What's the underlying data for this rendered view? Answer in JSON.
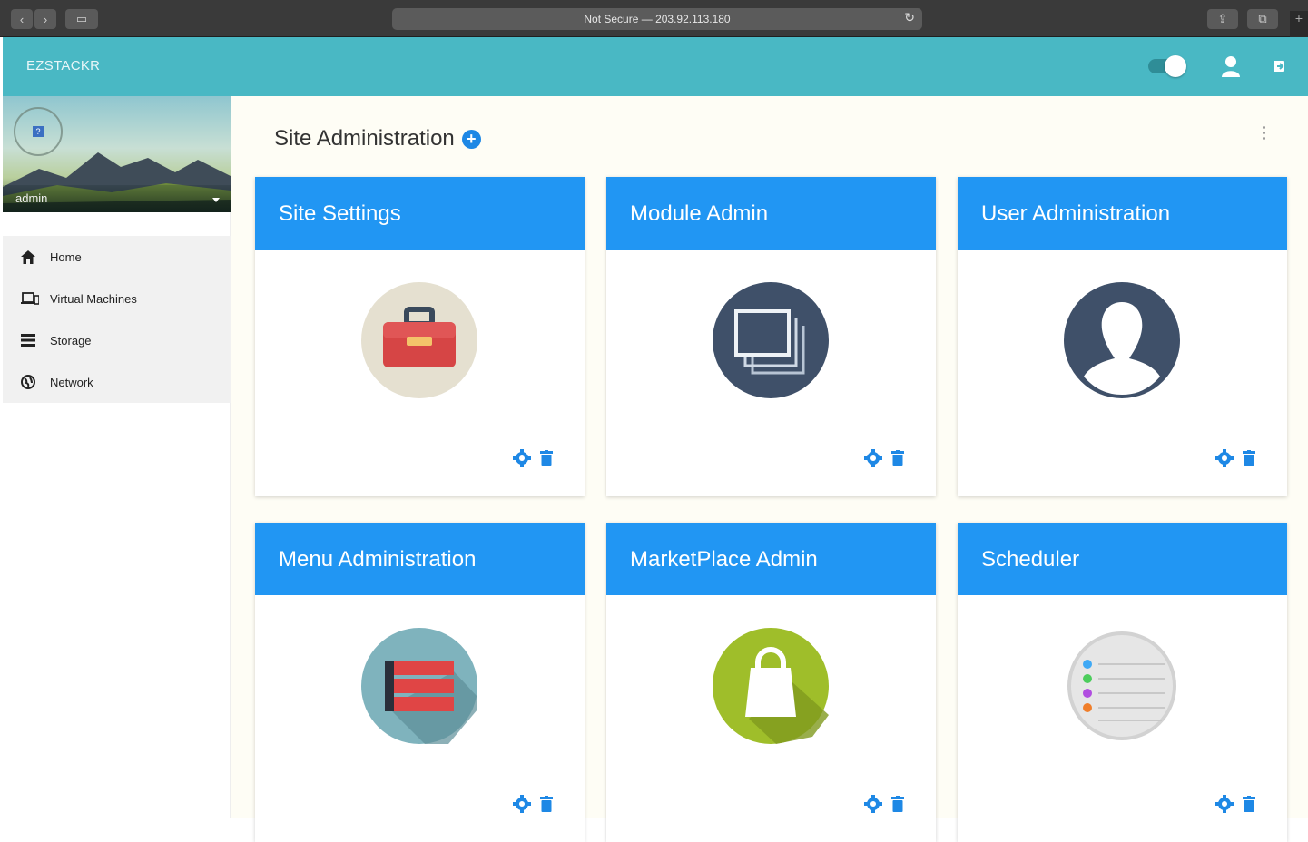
{
  "browser": {
    "address": "Not Secure — 203.92.113.180",
    "colors": {
      "chrome": "#3a3a3a"
    }
  },
  "header": {
    "brand": "EZSTACKR",
    "color": "#49b8c4",
    "icons": [
      "toggle-switch",
      "user-icon",
      "logout-icon"
    ]
  },
  "sidebar": {
    "username": "admin",
    "items": [
      {
        "label": "Home",
        "icon": "home-icon"
      },
      {
        "label": "Virtual Machines",
        "icon": "laptop-icon"
      },
      {
        "label": "Storage",
        "icon": "list-icon"
      },
      {
        "label": "Network",
        "icon": "globe-icon"
      }
    ]
  },
  "main": {
    "title": "Site Administration",
    "accent": "#2196f3",
    "cards": [
      {
        "title": "Site Settings",
        "icon": "toolbox-icon"
      },
      {
        "title": "Module Admin",
        "icon": "windows-stack-icon"
      },
      {
        "title": "User Administration",
        "icon": "user-silhouette-icon"
      },
      {
        "title": "Menu Administration",
        "icon": "menu-stack-icon"
      },
      {
        "title": "MarketPlace Admin",
        "icon": "shopping-bag-icon"
      },
      {
        "title": "Scheduler",
        "icon": "list-notes-icon"
      }
    ]
  }
}
